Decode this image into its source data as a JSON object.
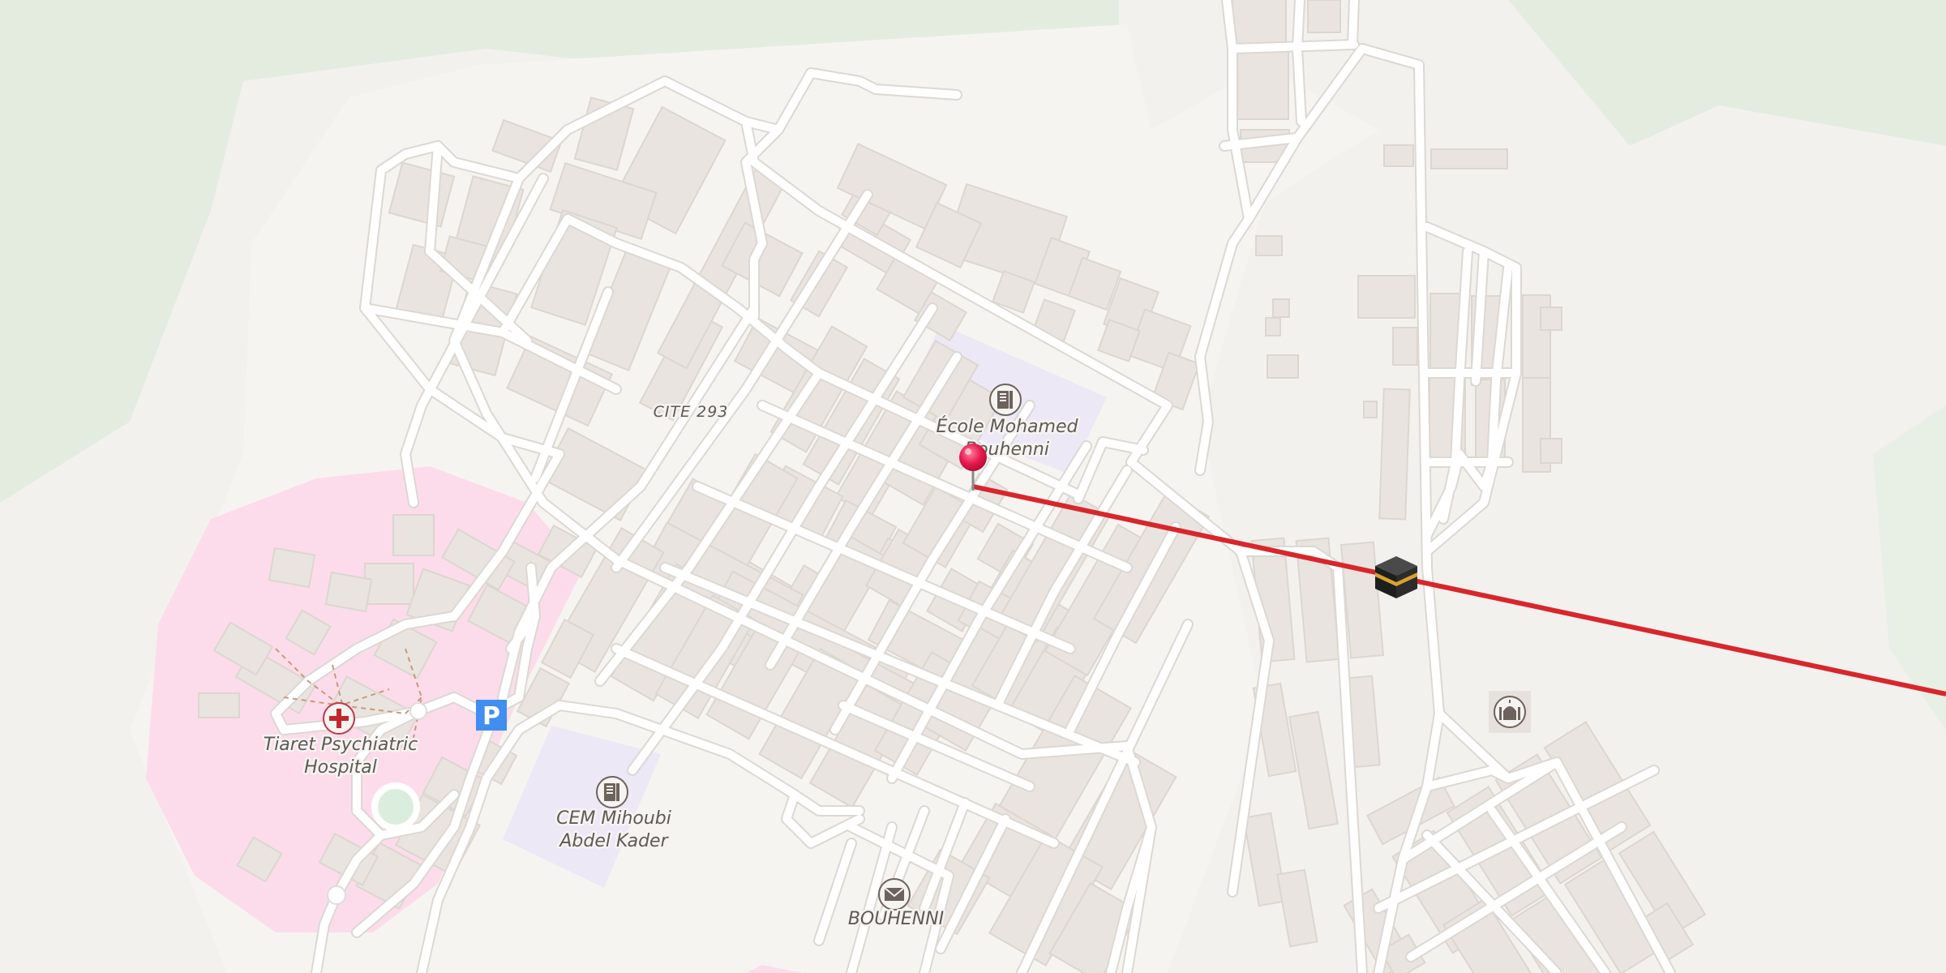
{
  "map": {
    "labels": {
      "district": "CITE 293",
      "school_1_line1": "École Mohamed",
      "school_1_line2": "Bouhenni",
      "school_2_line1": "CEM Mihoubi",
      "school_2_line2": "Abdel Kader",
      "hospital_line1": "Tiaret Psychiatric",
      "hospital_line2": "Hospital",
      "post_office": "BOUHENNI",
      "parking": "P"
    },
    "icons": [
      "school-icon",
      "hospital-icon",
      "parking-icon",
      "post-office-icon",
      "mosque-icon",
      "kaaba-icon",
      "location-pin-icon"
    ],
    "colors": {
      "background": "#f3f1ee",
      "vegetation": "#e4ecdf",
      "residential": "#f6f4f1",
      "building": "#e9e4df",
      "school_area": "#ece8f6",
      "hospital_area": "#fcdcea",
      "road": "#ffffff",
      "road_casing": "#dcd8d3",
      "qibla_line": "#d9262b",
      "pin": "#e8184f",
      "parking": "#3f8ef0"
    }
  }
}
